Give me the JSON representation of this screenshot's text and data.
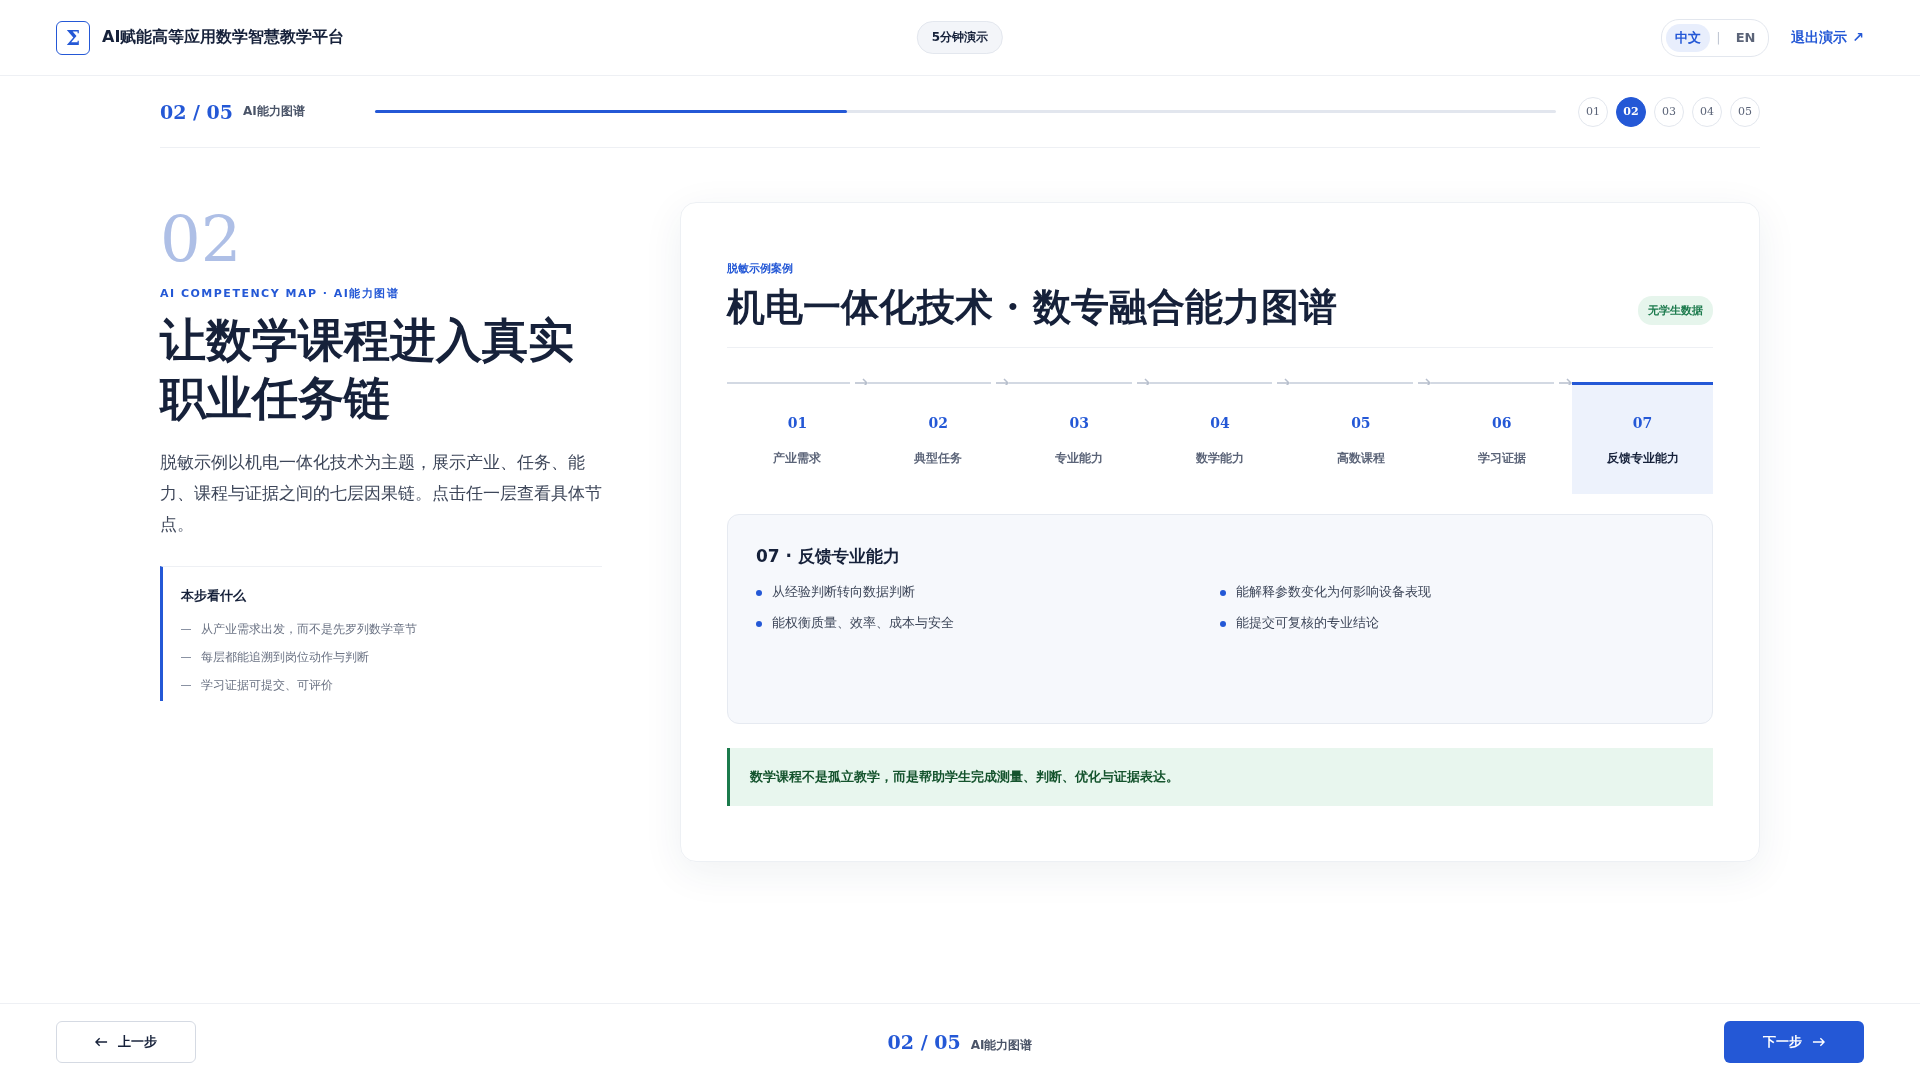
{
  "header": {
    "logo": "Σ",
    "title": "AI赋能高等应用数学智慧教学平台",
    "demo_badge": "5分钟演示",
    "languages": [
      {
        "label": "中文",
        "selected": true
      },
      {
        "label": "EN",
        "selected": false
      }
    ],
    "language_separator": "|",
    "exit_link": "退出演示 ↗"
  },
  "progress": {
    "counter": "02 / 05",
    "label": "AI能力图谱",
    "level": 0.4,
    "steps": [
      {
        "label": "01",
        "selected": false
      },
      {
        "label": "02",
        "selected": true
      },
      {
        "label": "03",
        "selected": false
      },
      {
        "label": "04",
        "selected": false
      },
      {
        "label": "05",
        "selected": false
      }
    ]
  },
  "intro": {
    "big_number": "02",
    "kicker": "AI COMPETENCY MAP · AI能力图谱",
    "heading": "让数学课程进入真实职业任务链",
    "paragraph": "脱敏示例以机电一体化技术为主题，展示产业、任务、能力、课程与证据之间的七层因果链。点击任一层查看具体节点。",
    "focus": {
      "title": "本步看什么",
      "items": [
        "从产业需求出发，而不是先罗列数学章节",
        "每层都能追溯到岗位动作与判断",
        "学习证据可提交、可评价"
      ]
    }
  },
  "card": {
    "kicker": "脱敏示例案例",
    "title": "机电一体化技术 · 数专融合能力图谱",
    "badge": "无学生数据",
    "layers": [
      {
        "number": "01",
        "label": "产业需求",
        "selected": false
      },
      {
        "number": "02",
        "label": "典型任务",
        "selected": false
      },
      {
        "number": "03",
        "label": "专业能力",
        "selected": false
      },
      {
        "number": "04",
        "label": "数学能力",
        "selected": false
      },
      {
        "number": "05",
        "label": "高数课程",
        "selected": false
      },
      {
        "number": "06",
        "label": "学习证据",
        "selected": false
      },
      {
        "number": "07",
        "label": "反馈专业能力",
        "selected": true
      }
    ],
    "detail": {
      "title": "07 · 反馈专业能力",
      "points": [
        "从经验判断转向数据判断",
        "能解释参数变化为何影响设备表现",
        "能权衡质量、效率、成本与安全",
        "能提交可复核的专业结论"
      ]
    },
    "note": "数学课程不是孤立教学，而是帮助学生完成测量、判断、优化与证据表达。"
  },
  "footer": {
    "prev": "上一步",
    "counter": "02 / 05",
    "label": "AI能力图谱",
    "next": "下一步"
  }
}
